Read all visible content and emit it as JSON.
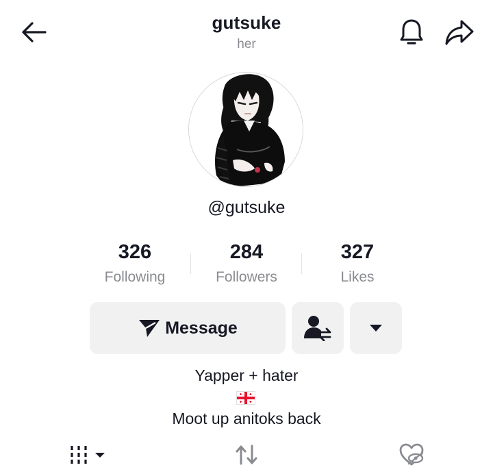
{
  "header": {
    "username": "gutsuke",
    "pronouns": "her"
  },
  "profile": {
    "handle": "@gutsuke"
  },
  "stats": [
    {
      "value": "326",
      "label": "Following"
    },
    {
      "value": "284",
      "label": "Followers"
    },
    {
      "value": "327",
      "label": "Likes"
    }
  ],
  "actions": {
    "message_label": "Message"
  },
  "bio": {
    "line1": "Yapper + hater",
    "line3": "Moot up anitoks back"
  },
  "icons": {
    "back": "back-arrow-icon",
    "bell": "bell-icon",
    "share": "share-icon",
    "message": "send-icon",
    "friends": "user-swap-icon",
    "more": "caret-down-icon",
    "flag": "georgia-flag-icon",
    "videos_tab": "grid-icon",
    "reposts_tab": "repost-icon",
    "liked_tab": "hidden-heart-icon"
  },
  "colors": {
    "text": "#161823",
    "secondary": "#8a8b91",
    "button_bg": "#f1f1f2",
    "flag_red": "#e8112d"
  }
}
